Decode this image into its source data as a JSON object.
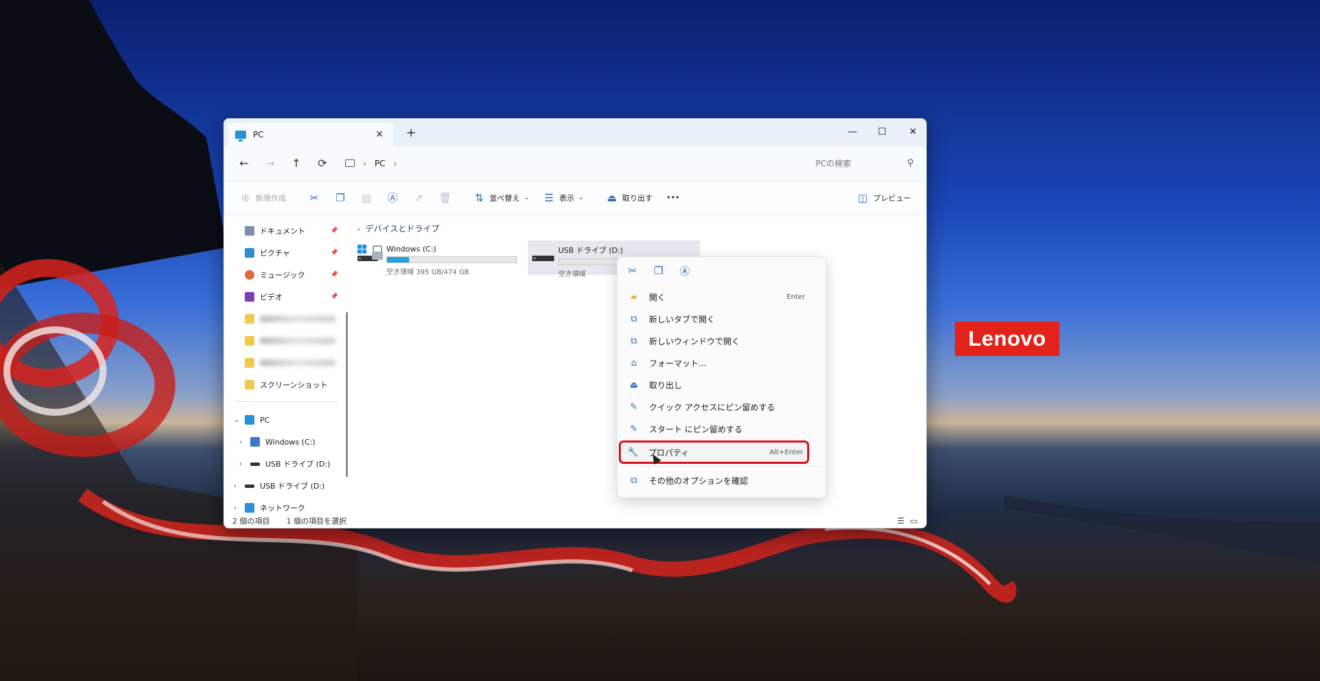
{
  "brand": {
    "logo_text": "Lenovo",
    "color": "#e2231a"
  },
  "window": {
    "tab_title": "PC",
    "tab_close": "✕",
    "new_tab": "+",
    "controls": {
      "minimize": "—",
      "maximize": "☐",
      "close": "✕"
    }
  },
  "address": {
    "back": "←",
    "forward": "→",
    "up": "↑",
    "refresh": "⟳",
    "breadcrumb": "PC",
    "search_placeholder": "PCの検索"
  },
  "toolbar": {
    "new": "新規作成",
    "sort": "並べ替え",
    "view": "表示",
    "eject": "取り出す",
    "more": "•••",
    "preview": "プレビュー"
  },
  "sidebar": {
    "quick": [
      {
        "label": "ドキュメント",
        "icon": "document-icon",
        "color": "#7b8fb0"
      },
      {
        "label": "ピクチャ",
        "icon": "pictures-icon",
        "color": "#2f8bd6"
      },
      {
        "label": "ミュージック",
        "icon": "music-icon",
        "color": "#e06a3a"
      },
      {
        "label": "ビデオ",
        "icon": "video-icon",
        "color": "#7a3fb8"
      }
    ],
    "screenshots": "スクリーンショット",
    "tree": [
      {
        "label": "PC",
        "chevron": "⌄"
      },
      {
        "label": "Windows (C:)",
        "chevron": "›"
      },
      {
        "label": "USB ドライブ (D:)",
        "chevron": "›"
      },
      {
        "label": "USB ドライブ (D:)",
        "chevron": "›"
      },
      {
        "label": "ネットワーク",
        "chevron": "›"
      }
    ]
  },
  "main": {
    "group_header": "デバイスとドライブ",
    "drives": [
      {
        "name": "Windows (C:)",
        "free": "空き領域 395 GB/474 GB",
        "used_fraction": 0.17
      },
      {
        "name": "USB ドライブ (D:)",
        "free": "空き領域",
        "used_fraction": 0.0
      }
    ]
  },
  "status": {
    "items": "2 個の項目",
    "selected": "1 個の項目を選択"
  },
  "context_menu": {
    "items": [
      {
        "label": "開く",
        "shortcut": "Enter",
        "icon": "folder-open-icon"
      },
      {
        "label": "新しいタブで開く",
        "shortcut": "",
        "icon": "open-new-tab-icon"
      },
      {
        "label": "新しいウィンドウで開く",
        "shortcut": "",
        "icon": "open-new-window-icon"
      },
      {
        "label": "フォーマット...",
        "shortcut": "",
        "icon": "format-icon"
      },
      {
        "label": "取り出し",
        "shortcut": "",
        "icon": "eject-icon"
      },
      {
        "label": "クイック アクセスにピン留めする",
        "shortcut": "",
        "icon": "pin-icon"
      },
      {
        "label": "スタート にピン留めする",
        "shortcut": "",
        "icon": "pin-start-icon"
      },
      {
        "label": "プロパティ",
        "shortcut": "Alt+Enter",
        "icon": "wrench-icon"
      },
      {
        "label": "その他のオプションを確認",
        "shortcut": "",
        "icon": "more-options-icon"
      }
    ]
  }
}
